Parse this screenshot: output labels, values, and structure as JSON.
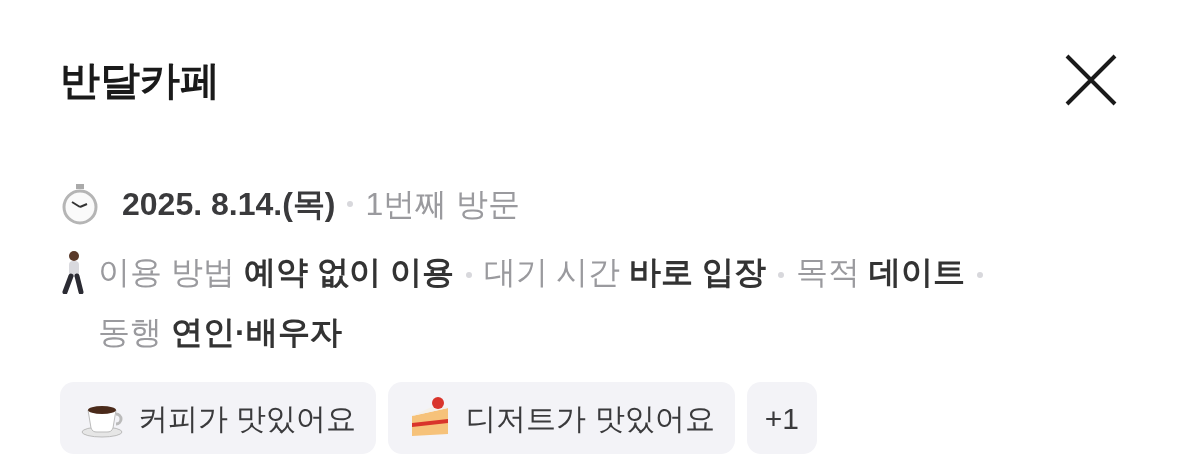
{
  "title": "반달카페",
  "visit": {
    "date": "2025. 8.14.(목)",
    "count": "1번째 방문"
  },
  "details": [
    {
      "label": "이용 방법",
      "value": "예약 없이 이용"
    },
    {
      "label": "대기 시간",
      "value": "바로 입장"
    },
    {
      "label": "목적",
      "value": "데이트"
    },
    {
      "label": "동행",
      "value": "연인·배우자"
    }
  ],
  "tags": [
    {
      "label": "커피가 맛있어요",
      "kind": "coffee"
    },
    {
      "label": "디저트가 맛있어요",
      "kind": "cake"
    },
    {
      "label": "+1",
      "kind": "more"
    }
  ]
}
